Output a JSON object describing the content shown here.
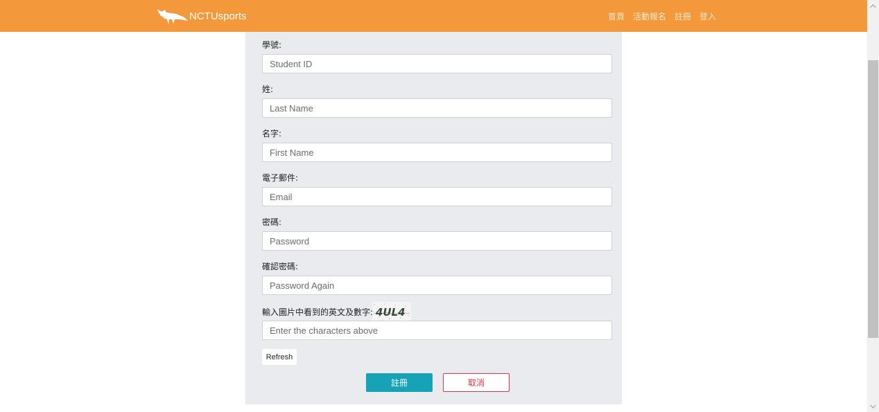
{
  "navbar": {
    "brand_name": "NCTUsports",
    "brand_color": "#f3993b",
    "links": [
      "首頁",
      "活動報名",
      "註冊",
      "登入"
    ]
  },
  "form": {
    "fields": [
      {
        "label": "學號:",
        "placeholder": "Student ID"
      },
      {
        "label": "姓:",
        "placeholder": "Last Name"
      },
      {
        "label": "名字:",
        "placeholder": "First Name"
      },
      {
        "label": "電子郵件:",
        "placeholder": "Email"
      },
      {
        "label": "密碼:",
        "placeholder": "Password"
      },
      {
        "label": "確認密碼:",
        "placeholder": "Password Again"
      }
    ],
    "captcha": {
      "label": "輸入圖片中看到的英文及數字:",
      "text": "4UL4",
      "placeholder": "Enter the characters above",
      "refresh_label": "Refresh"
    },
    "submit_label": "註冊",
    "submit_color": "#17a2b8",
    "cancel_label": "取消",
    "cancel_color": "#dc3545"
  },
  "icons": {
    "brand_logo": "fox-logo-icon",
    "scroll_up": "chevron-up-icon",
    "scroll_down": "chevron-down-icon"
  }
}
